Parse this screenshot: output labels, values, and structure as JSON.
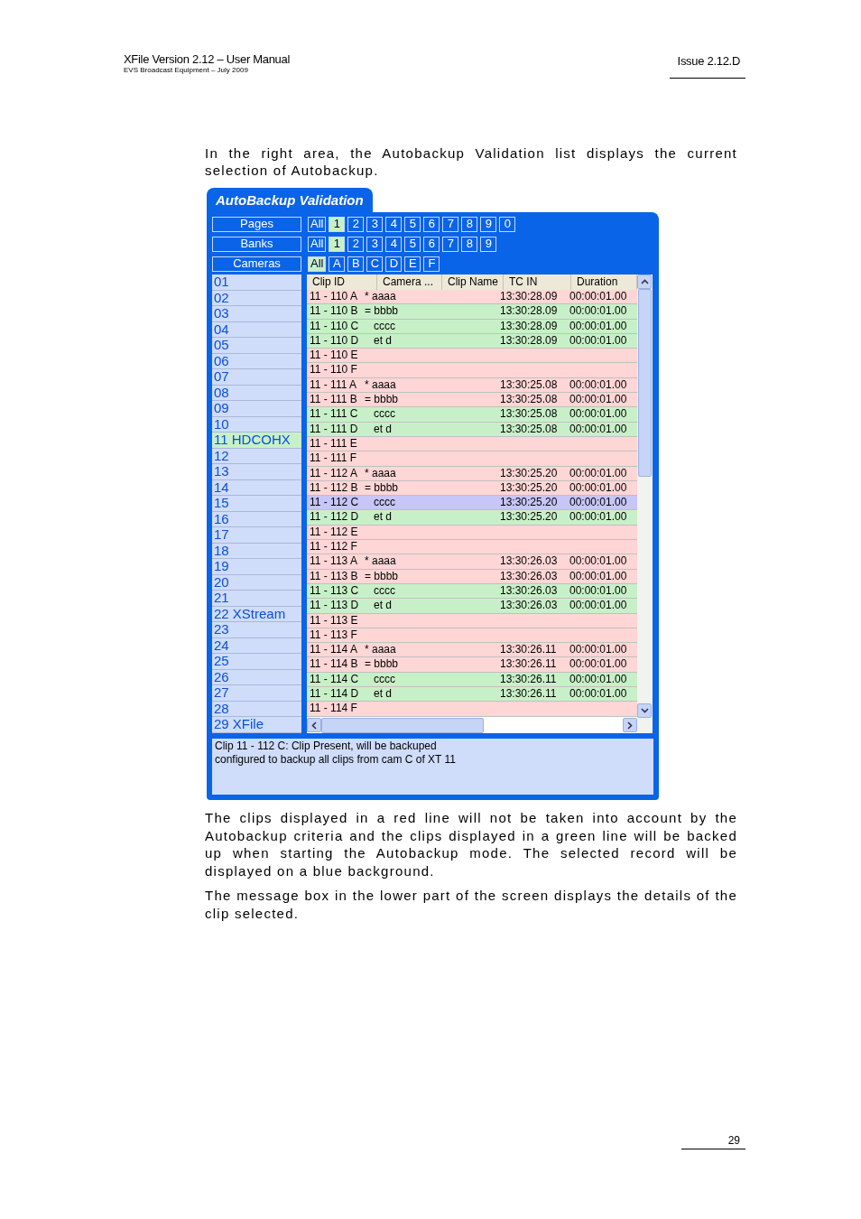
{
  "header": {
    "title": "XFile Version 2.12 – User Manual",
    "subtitle": "EVS Broadcast Equipment – July 2009",
    "issue": "Issue 2.12.D"
  },
  "intro": "In the right area, the Autobackup Validation list displays the current selection of Autobackup.",
  "window": {
    "title": "AutoBackup Validation",
    "filters": [
      {
        "label": "Pages",
        "options": [
          {
            "text": "All",
            "selected": false
          },
          {
            "text": "1",
            "selected": true
          },
          {
            "text": "2",
            "selected": false
          },
          {
            "text": "3",
            "selected": false
          },
          {
            "text": "4",
            "selected": false
          },
          {
            "text": "5",
            "selected": false
          },
          {
            "text": "6",
            "selected": false
          },
          {
            "text": "7",
            "selected": false
          },
          {
            "text": "8",
            "selected": false
          },
          {
            "text": "9",
            "selected": false
          },
          {
            "text": "0",
            "selected": false
          }
        ]
      },
      {
        "label": "Banks",
        "options": [
          {
            "text": "All",
            "selected": false
          },
          {
            "text": "1",
            "selected": true
          },
          {
            "text": "2",
            "selected": false
          },
          {
            "text": "3",
            "selected": false
          },
          {
            "text": "4",
            "selected": false
          },
          {
            "text": "5",
            "selected": false
          },
          {
            "text": "6",
            "selected": false
          },
          {
            "text": "7",
            "selected": false
          },
          {
            "text": "8",
            "selected": false
          },
          {
            "text": "9",
            "selected": false
          }
        ]
      },
      {
        "label": "Cameras",
        "options": [
          {
            "text": "All",
            "selected": true
          },
          {
            "text": "A",
            "selected": false
          },
          {
            "text": "B",
            "selected": false
          },
          {
            "text": "C",
            "selected": false
          },
          {
            "text": "D",
            "selected": false
          },
          {
            "text": "E",
            "selected": false
          },
          {
            "text": "F",
            "selected": false
          }
        ]
      }
    ],
    "servers": [
      {
        "text": "01",
        "selected": false
      },
      {
        "text": "02",
        "selected": false
      },
      {
        "text": "03",
        "selected": false
      },
      {
        "text": "04",
        "selected": false
      },
      {
        "text": "05",
        "selected": false
      },
      {
        "text": "06",
        "selected": false
      },
      {
        "text": "07",
        "selected": false
      },
      {
        "text": "08",
        "selected": false
      },
      {
        "text": "09",
        "selected": false
      },
      {
        "text": "10",
        "selected": false
      },
      {
        "text": "11 HDCOHX",
        "selected": true
      },
      {
        "text": "12",
        "selected": false
      },
      {
        "text": "13",
        "selected": false
      },
      {
        "text": "14",
        "selected": false
      },
      {
        "text": "15",
        "selected": false
      },
      {
        "text": "16",
        "selected": false
      },
      {
        "text": "17",
        "selected": false
      },
      {
        "text": "18",
        "selected": false
      },
      {
        "text": "19",
        "selected": false
      },
      {
        "text": "20",
        "selected": false
      },
      {
        "text": "21",
        "selected": false
      },
      {
        "text": "22 XStream",
        "selected": false
      },
      {
        "text": "23",
        "selected": false
      },
      {
        "text": "24",
        "selected": false
      },
      {
        "text": "25",
        "selected": false
      },
      {
        "text": "26",
        "selected": false
      },
      {
        "text": "27",
        "selected": false
      },
      {
        "text": "28",
        "selected": false
      },
      {
        "text": "29 XFile",
        "selected": false
      }
    ],
    "table": {
      "columns": [
        "Clip ID",
        "Camera ...",
        "Clip Name",
        "TC IN",
        "Duration"
      ],
      "rows": [
        {
          "clip_id": "11 - 110 A",
          "camera": "* aaaa",
          "tc_in": "13:30:28.09",
          "duration": "00:00:01.00",
          "backup": false,
          "selected": false
        },
        {
          "clip_id": "11 - 110 B",
          "camera": "= bbbb",
          "tc_in": "13:30:28.09",
          "duration": "00:00:01.00",
          "backup": true,
          "selected": false
        },
        {
          "clip_id": "11 - 110 C",
          "camera": "cccc",
          "tc_in": "13:30:28.09",
          "duration": "00:00:01.00",
          "backup": true,
          "selected": false
        },
        {
          "clip_id": "11 - 110 D",
          "camera": "et d",
          "tc_in": "13:30:28.09",
          "duration": "00:00:01.00",
          "backup": true,
          "selected": false
        },
        {
          "clip_id": "11 - 110 E",
          "backup": false,
          "selected": false
        },
        {
          "clip_id": "11 - 110 F",
          "backup": false,
          "selected": false
        },
        {
          "clip_id": "11 - 111 A",
          "camera": "* aaaa",
          "tc_in": "13:30:25.08",
          "duration": "00:00:01.00",
          "backup": false,
          "selected": false
        },
        {
          "clip_id": "11 - 111 B",
          "camera": "= bbbb",
          "tc_in": "13:30:25.08",
          "duration": "00:00:01.00",
          "backup": false,
          "selected": false
        },
        {
          "clip_id": "11 - 111 C",
          "camera": "cccc",
          "tc_in": "13:30:25.08",
          "duration": "00:00:01.00",
          "backup": true,
          "selected": false
        },
        {
          "clip_id": "11 - 111 D",
          "camera": "et d",
          "tc_in": "13:30:25.08",
          "duration": "00:00:01.00",
          "backup": true,
          "selected": false
        },
        {
          "clip_id": "11 - 111 E",
          "backup": false,
          "selected": false
        },
        {
          "clip_id": "11 - 111 F",
          "backup": false,
          "selected": false
        },
        {
          "clip_id": "11 - 112 A",
          "camera": "* aaaa",
          "tc_in": "13:30:25.20",
          "duration": "00:00:01.00",
          "backup": false,
          "selected": false
        },
        {
          "clip_id": "11 - 112 B",
          "camera": "= bbbb",
          "tc_in": "13:30:25.20",
          "duration": "00:00:01.00",
          "backup": false,
          "selected": false
        },
        {
          "clip_id": "11 - 112 C",
          "camera": "cccc",
          "tc_in": "13:30:25.20",
          "duration": "00:00:01.00",
          "selected": true
        },
        {
          "clip_id": "11 - 112 D",
          "camera": "et d",
          "tc_in": "13:30:25.20",
          "duration": "00:00:01.00",
          "backup": true,
          "selected": false
        },
        {
          "clip_id": "11 - 112 E",
          "backup": false,
          "selected": false
        },
        {
          "clip_id": "11 - 112 F",
          "backup": false,
          "selected": false
        },
        {
          "clip_id": "11 - 113 A",
          "camera": "* aaaa",
          "tc_in": "13:30:26.03",
          "duration": "00:00:01.00",
          "backup": false,
          "selected": false
        },
        {
          "clip_id": "11 - 113 B",
          "camera": "= bbbb",
          "tc_in": "13:30:26.03",
          "duration": "00:00:01.00",
          "backup": false,
          "selected": false
        },
        {
          "clip_id": "11 - 113 C",
          "camera": "cccc",
          "tc_in": "13:30:26.03",
          "duration": "00:00:01.00",
          "backup": true,
          "selected": false
        },
        {
          "clip_id": "11 - 113 D",
          "camera": "et d",
          "tc_in": "13:30:26.03",
          "duration": "00:00:01.00",
          "backup": true,
          "selected": false
        },
        {
          "clip_id": "11 - 113 E",
          "backup": false,
          "selected": false
        },
        {
          "clip_id": "11 - 113 F",
          "backup": false,
          "selected": false
        },
        {
          "clip_id": "11 - 114 A",
          "camera": "* aaaa",
          "tc_in": "13:30:26.11",
          "duration": "00:00:01.00",
          "backup": false,
          "selected": false
        },
        {
          "clip_id": "11 - 114 B",
          "camera": "= bbbb",
          "tc_in": "13:30:26.11",
          "duration": "00:00:01.00",
          "backup": false,
          "selected": false
        },
        {
          "clip_id": "11 - 114 C",
          "camera": "cccc",
          "tc_in": "13:30:26.11",
          "duration": "00:00:01.00",
          "backup": true,
          "selected": false
        },
        {
          "clip_id": "11 - 114 D",
          "camera": "et d",
          "tc_in": "13:30:26.11",
          "duration": "00:00:01.00",
          "backup": true,
          "selected": false
        },
        {
          "clip_id": "11 - 114 F",
          "backup": false,
          "selected": false
        }
      ]
    },
    "message": [
      "Clip 11 - 112 C:  Clip Present, will be backuped",
      "configured to backup all clips from cam C of XT 11"
    ]
  },
  "paragraphs": [
    "The clips displayed in a red line will not be taken into account by the Autobackup criteria and the clips displayed in a green line will be backed up when starting the Autobackup mode. The selected record will be displayed on a blue background.",
    "The message box in the lower part of the screen displays the details of the clip selected."
  ],
  "page_number": "29"
}
